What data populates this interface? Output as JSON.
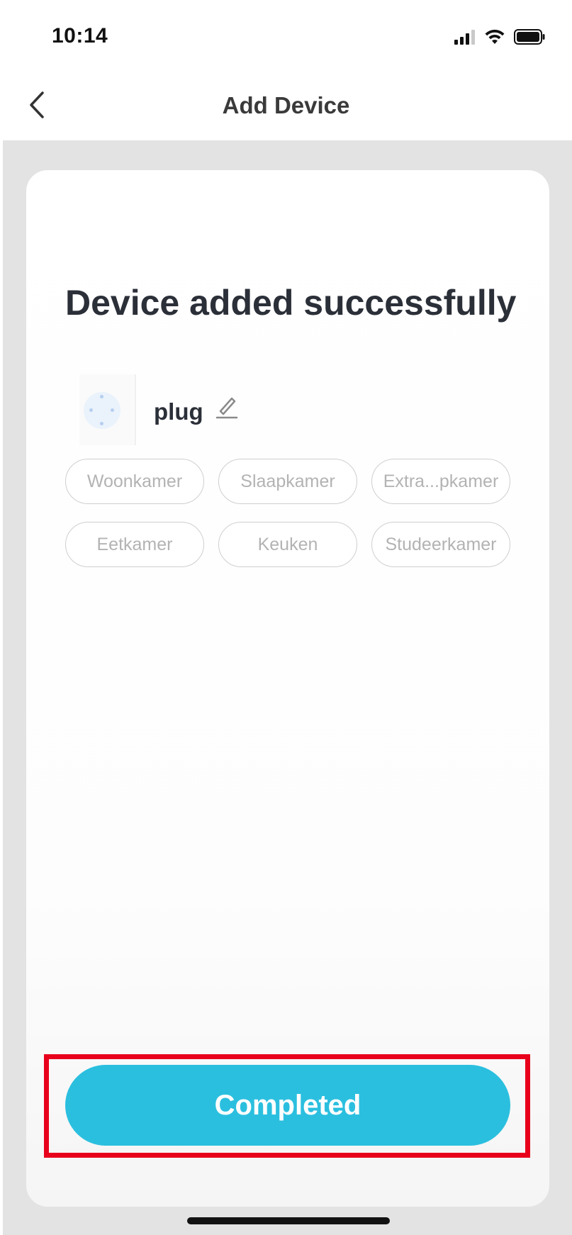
{
  "status_bar": {
    "time": "10:14"
  },
  "nav": {
    "title": "Add Device"
  },
  "content": {
    "headline": "Device added successfully",
    "device_name": "plug"
  },
  "rooms": [
    {
      "label": "Woonkamer"
    },
    {
      "label": "Slaapkamer"
    },
    {
      "label": "Extra...pkamer"
    },
    {
      "label": "Eetkamer"
    },
    {
      "label": "Keuken"
    },
    {
      "label": "Studeerkamer"
    }
  ],
  "actions": {
    "completed_label": "Completed"
  },
  "colors": {
    "accent": "#2bbfdf",
    "highlight": "#e8001c",
    "backdrop": "#e3e3e3"
  }
}
